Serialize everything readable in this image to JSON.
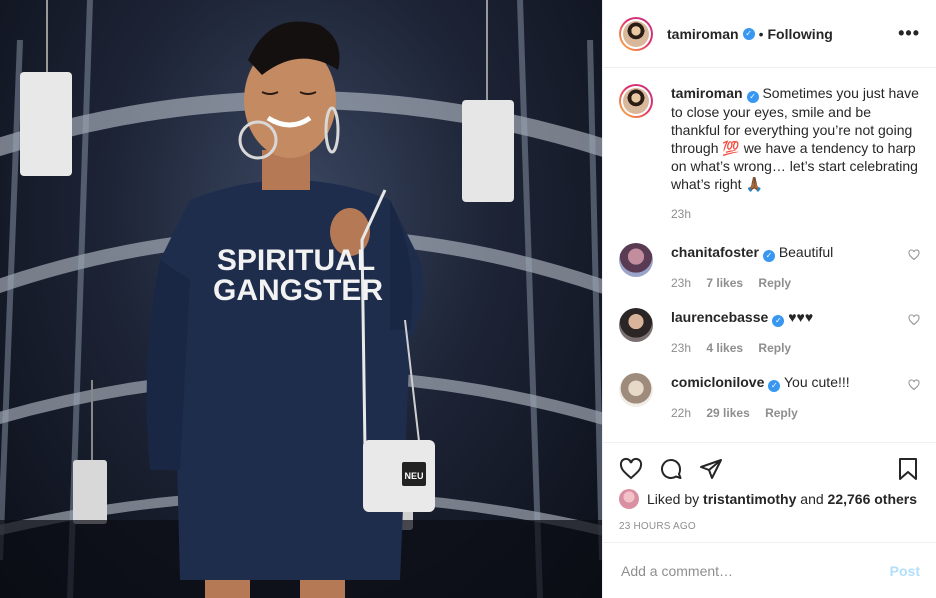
{
  "post": {
    "author": "tamiroman",
    "following_label": "Following",
    "more_label": "•••",
    "photo_text_line1": "SPIRITUAL",
    "photo_text_line2": "GANGSTER",
    "photo_bag_text": "NEU"
  },
  "caption": {
    "user": "tamiroman",
    "text": "Sometimes you just have to close your eyes, smile and be thankful for everything you’re not going through 💯 we have a tendency to harp on what’s wrong… let’s start celebrating what’s right 🙏🏾",
    "time": "23h"
  },
  "comments": [
    {
      "user": "chanitafoster",
      "text": "Beautiful",
      "time": "23h",
      "likes": "7 likes",
      "reply": "Reply"
    },
    {
      "user": "laurencebasse",
      "text": "♥♥♥",
      "time": "23h",
      "likes": "4 likes",
      "reply": "Reply"
    },
    {
      "user": "comiclonilove",
      "text": "You cute!!!",
      "time": "22h",
      "likes": "29 likes",
      "reply": "Reply"
    }
  ],
  "likes": {
    "prefix": "Liked by",
    "user": "tristantimothy",
    "conj": "and",
    "others": "22,766 others"
  },
  "timestamp": "23 HOURS AGO",
  "add_comment": {
    "placeholder": "Add a comment…",
    "post_label": "Post"
  },
  "icons": {
    "like": "heart-icon",
    "comment": "comment-icon",
    "share": "share-icon",
    "save": "bookmark-icon",
    "verified": "verified-badge-icon"
  },
  "colors": {
    "verified": "#3897f0",
    "post_disabled": "#b2dffc",
    "muted": "#8e8e8e"
  }
}
